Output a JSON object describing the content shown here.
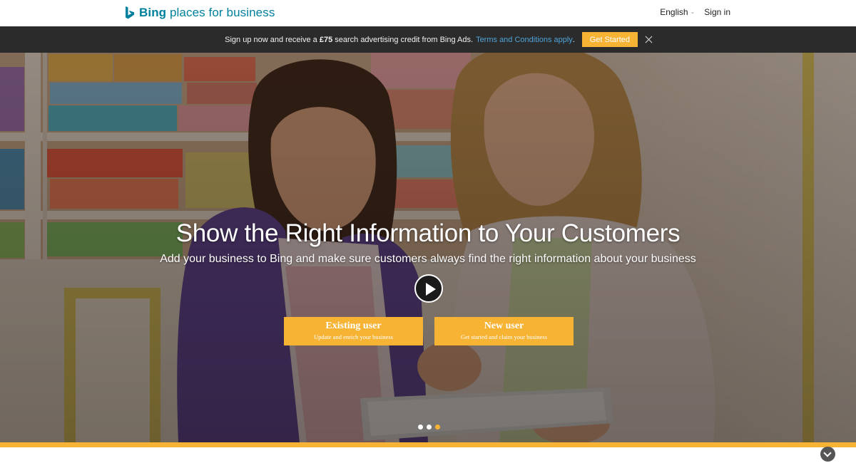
{
  "header": {
    "logo_bold": "Bing",
    "logo_rest": " places for business",
    "language": "English",
    "sign_in": "Sign in"
  },
  "promo": {
    "text_pre": "Sign up now and receive a ",
    "amount": "£75",
    "text_post": " search advertising credit from Bing Ads.",
    "link": "Terms and Conditions apply",
    "link_suffix": ".",
    "button": "Get Started"
  },
  "hero": {
    "title": "Show the Right Information to Your Customers",
    "subtitle": "Add your business to Bing and make sure customers always find the right information about your business",
    "existing_title": "Existing user",
    "existing_sub": "Update and enrich your business",
    "new_title": "New user",
    "new_sub": "Get started and claim your business",
    "carousel_dots": 3,
    "active_dot": 3
  },
  "colors": {
    "brand_teal": "#00809d",
    "accent_orange": "#f6b334",
    "promo_bg": "#2b2b2b",
    "link_blue": "#4fa3d9"
  },
  "icons": [
    "bing-logo-icon",
    "chevron-down-icon",
    "close-icon",
    "play-icon",
    "scroll-down-icon"
  ]
}
